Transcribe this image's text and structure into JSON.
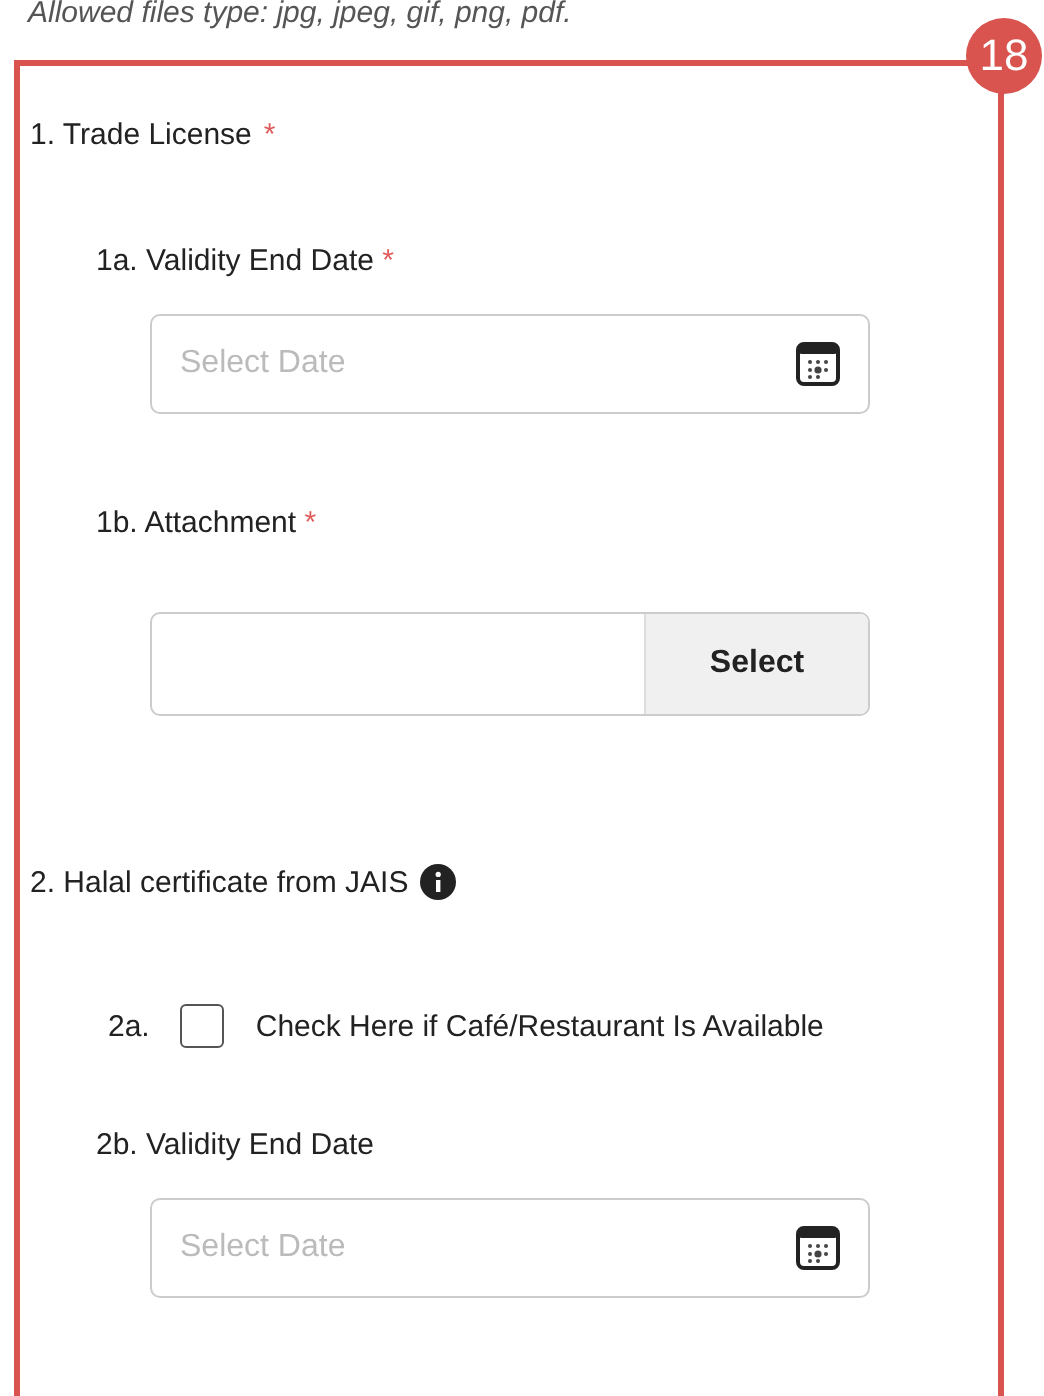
{
  "note": "Allowed files type: jpg, jpeg, gif, png, pdf.",
  "badge": "18",
  "sections": [
    {
      "title": "1. Trade License",
      "mark": "*",
      "items": [
        {
          "kind": "date",
          "label": "1a. Validity End Date",
          "mark": "*",
          "placeholder": "Select Date"
        },
        {
          "kind": "file",
          "label": "1b. Attachment",
          "mark": "*",
          "button": "Select"
        }
      ]
    },
    {
      "title": "2. Halal certificate from JAIS",
      "info": true,
      "items": [
        {
          "kind": "checkbox",
          "prefix": "2a.",
          "label": "Check Here if Café/Restaurant Is Available",
          "checked": false
        },
        {
          "kind": "date",
          "label": "2b. Validity End Date",
          "placeholder": "Select Date"
        }
      ]
    }
  ]
}
